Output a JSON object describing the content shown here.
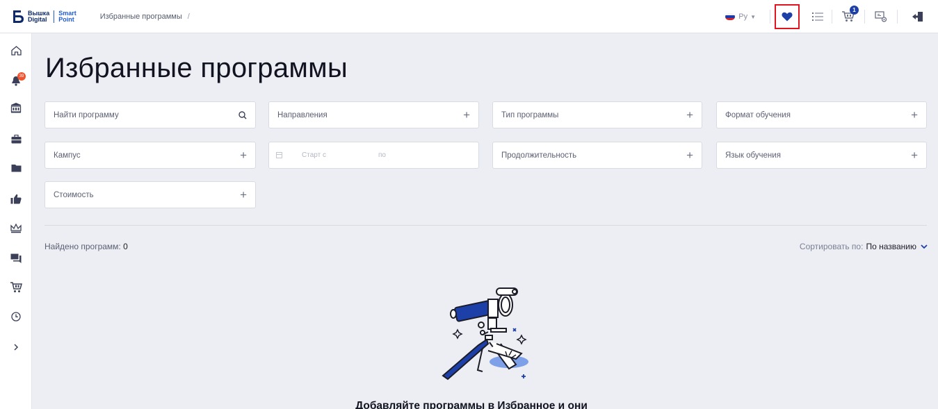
{
  "header": {
    "logo_line1": "Вышка",
    "logo_line2": "Digital",
    "logo_sub1": "Smart",
    "logo_sub2": "Point",
    "breadcrumb": "Избранные программы",
    "breadcrumb_sep": "/",
    "language": "Ру",
    "cart_badge": "1"
  },
  "sidebar": {
    "notification_badge": "39"
  },
  "main": {
    "title": "Избранные программы",
    "filters": {
      "search_placeholder": "Найти программу",
      "directions": "Направления",
      "program_type": "Тип программы",
      "study_format": "Формат обучения",
      "campus": "Кампус",
      "start_from": "Старт с",
      "start_to": "по",
      "duration": "Продолжительность",
      "language": "Язык обучения",
      "cost": "Стоимость"
    },
    "found_label": "Найдено программ:",
    "found_count": "0",
    "sort_label": "Сортировать по:",
    "sort_value": "По названию",
    "empty_text": "Добавляйте программы в Избранное и они"
  },
  "colors": {
    "accent": "#1d3fa8",
    "highlight_border": "#e0141e",
    "badge_orange": "#f0542d"
  }
}
